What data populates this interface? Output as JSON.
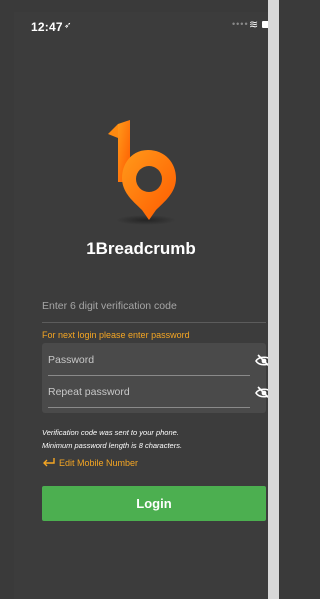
{
  "status_bar": {
    "time": "12:47",
    "location_glyph": "➶",
    "dots": "••••",
    "wifi_glyph": "≋"
  },
  "app": {
    "name": "1Breadcrumb"
  },
  "verification": {
    "placeholder": "Enter 6 digit verification code",
    "value": ""
  },
  "password_hint": "For next login please enter password",
  "password": {
    "placeholder": "Password",
    "value": ""
  },
  "repeat_password": {
    "placeholder": "Repeat password",
    "value": ""
  },
  "info": {
    "line1": "Verification code was sent to your phone.",
    "line2": "Minimum password length is 8 characters."
  },
  "edit_mobile_label": "Edit Mobile Number",
  "login_label": "Login",
  "colors": {
    "accent": "#f5a623",
    "login_green": "#4caf50",
    "background": "#3c3c3c",
    "logo_orange": "#ff7a00"
  },
  "icons": {
    "logo": "pin-logo",
    "eye": "eye-off-icon",
    "edit": "return-arrow-icon"
  }
}
